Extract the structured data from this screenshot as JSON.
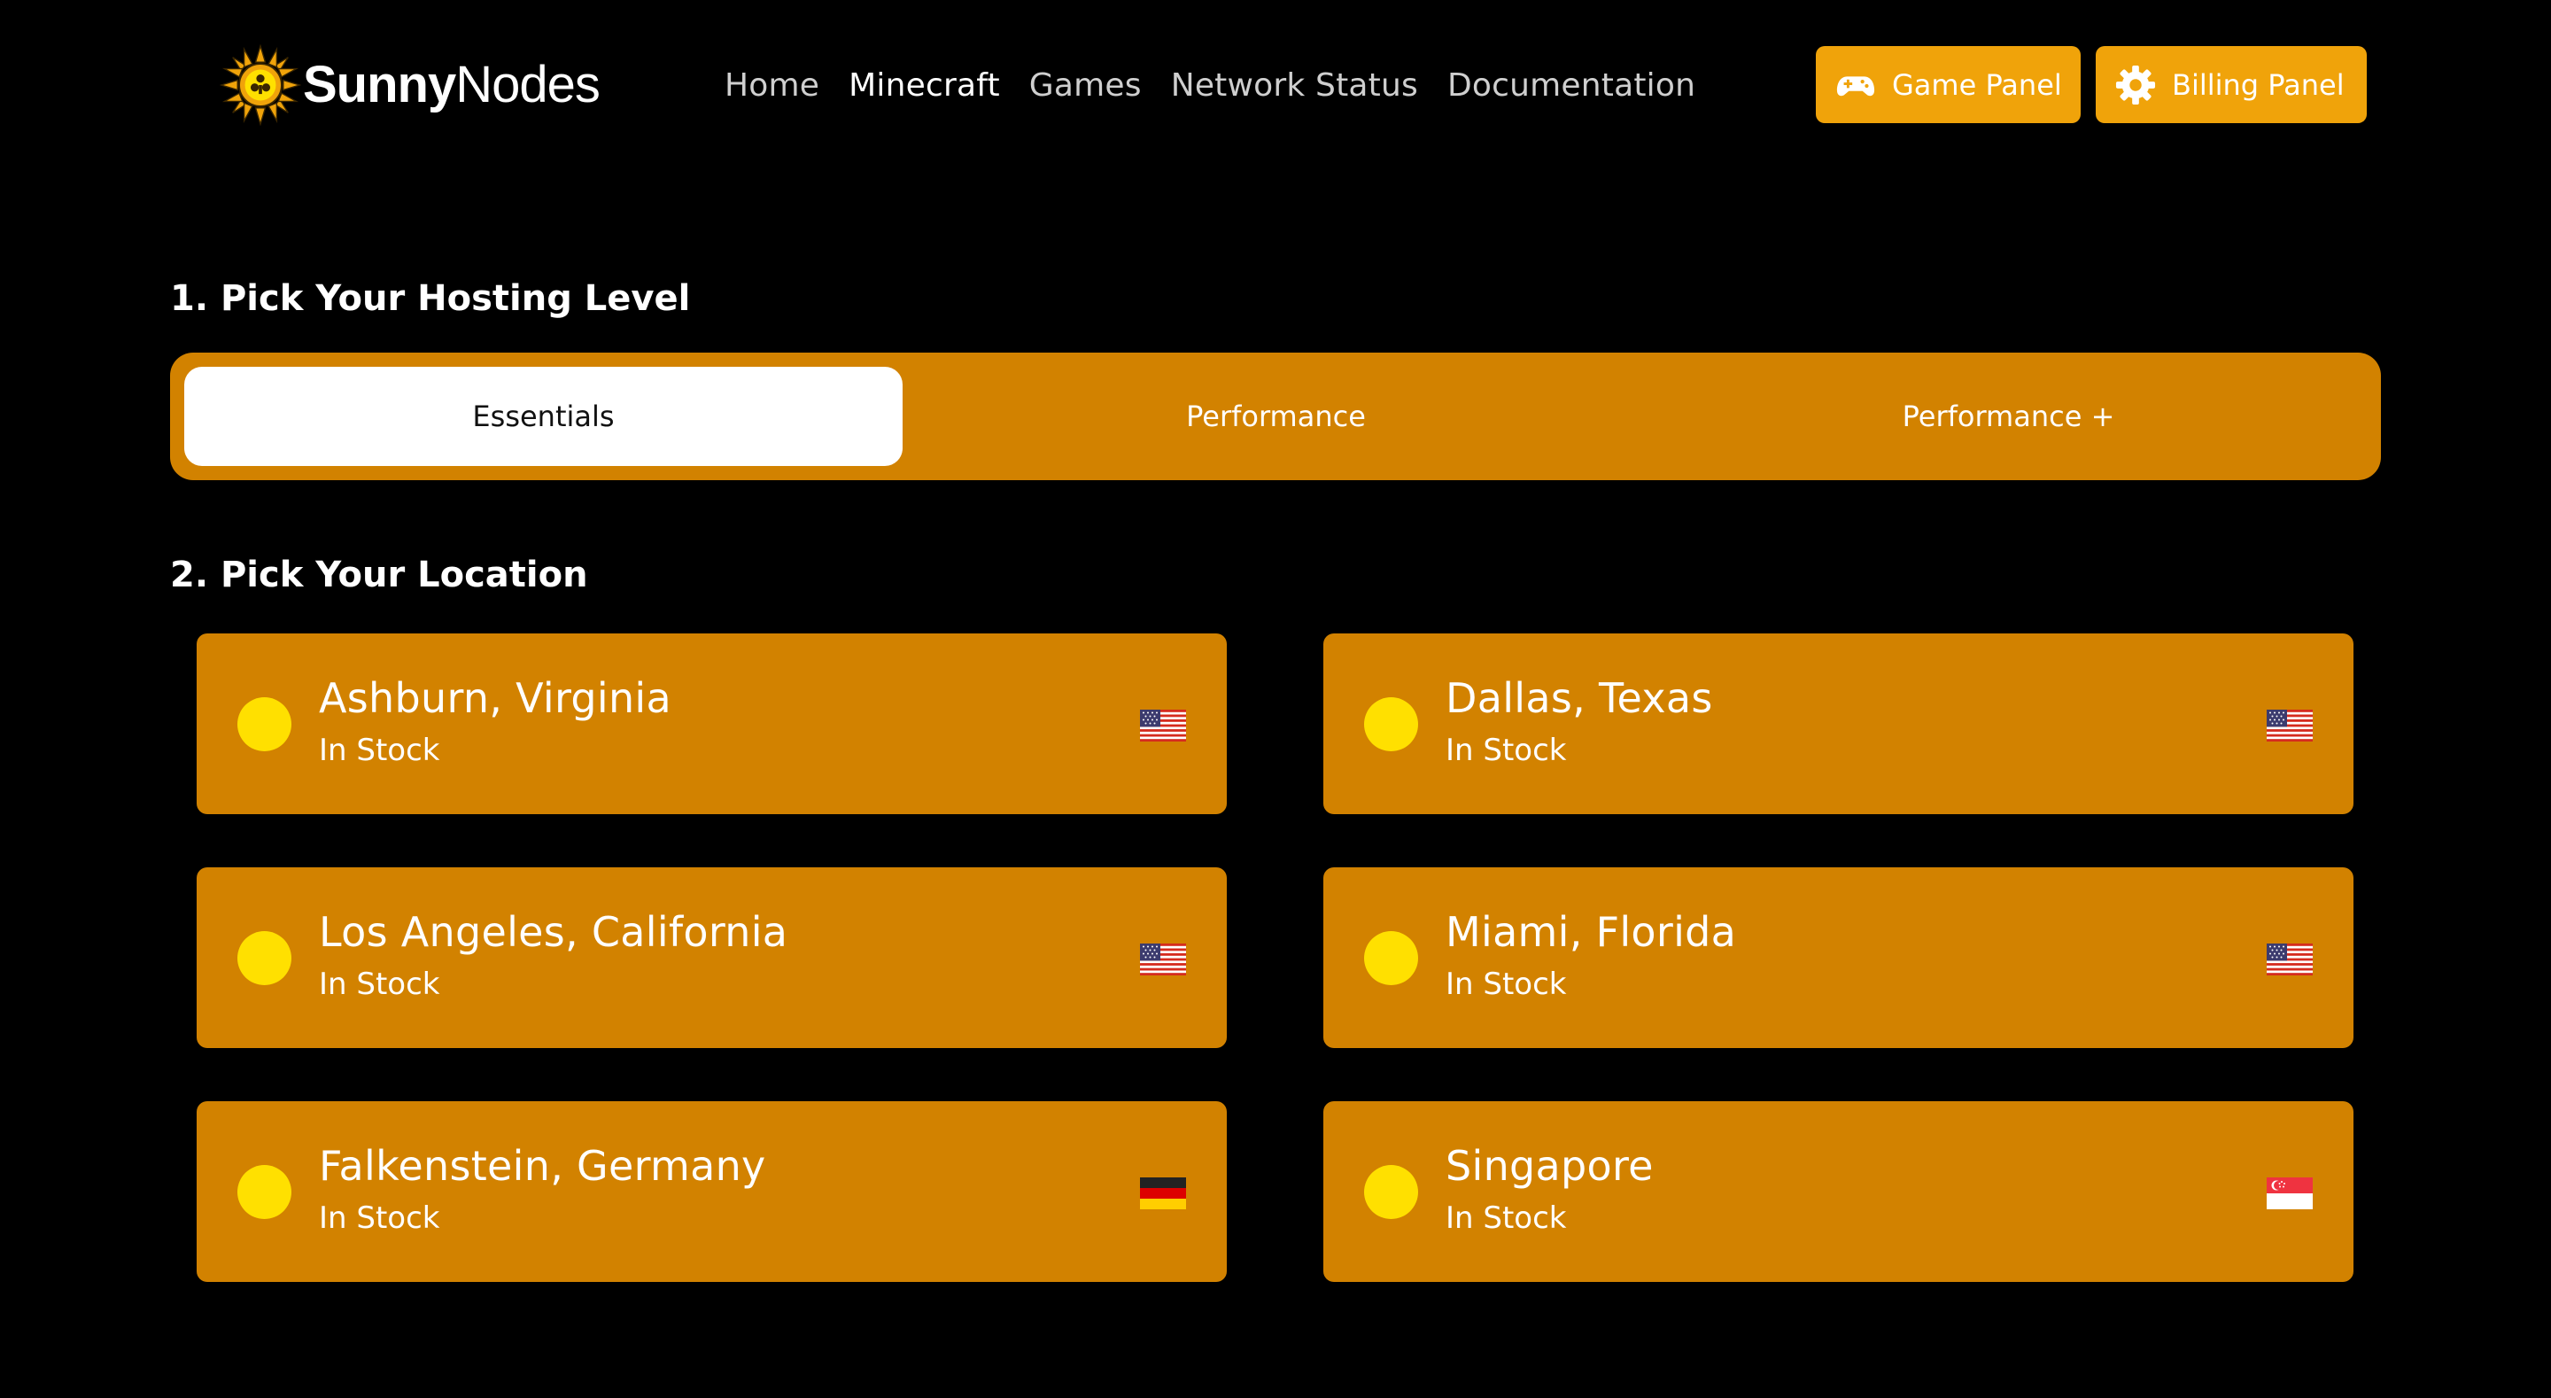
{
  "brand": {
    "name_bold": "Sunny",
    "name_light": "Nodes",
    "icon": "sun-logo-icon",
    "accent_color": "#f0a30a"
  },
  "nav": {
    "items": [
      {
        "label": "Home",
        "active": false
      },
      {
        "label": "Minecraft",
        "active": true
      },
      {
        "label": "Games",
        "active": false
      },
      {
        "label": "Network Status",
        "active": false
      },
      {
        "label": "Documentation",
        "active": false
      }
    ]
  },
  "header_buttons": {
    "game_panel": {
      "label": "Game Panel",
      "icon": "gamepad-icon"
    },
    "billing_panel": {
      "label": "Billing Panel",
      "icon": "gear-icon"
    }
  },
  "hosting": {
    "title": "1. Pick Your Hosting Level",
    "tiers": [
      {
        "label": "Essentials",
        "selected": true
      },
      {
        "label": "Performance",
        "selected": false
      },
      {
        "label": "Performance +",
        "selected": false
      }
    ]
  },
  "location": {
    "title": "2. Pick Your Location",
    "items": [
      {
        "name": "Ashburn, Virginia",
        "status": "In Stock",
        "flag": "us-flag-icon"
      },
      {
        "name": "Dallas, Texas",
        "status": "In Stock",
        "flag": "us-flag-icon"
      },
      {
        "name": "Los Angeles, California",
        "status": "In Stock",
        "flag": "us-flag-icon"
      },
      {
        "name": "Miami, Florida",
        "status": "In Stock",
        "flag": "us-flag-icon"
      },
      {
        "name": "Falkenstein, Germany",
        "status": "In Stock",
        "flag": "germany-flag-icon"
      },
      {
        "name": "Singapore",
        "status": "In Stock",
        "flag": "singapore-flag-icon"
      }
    ]
  },
  "colors": {
    "background": "#000000",
    "card": "#d28200",
    "radio": "#ffe000",
    "selected_tier": "#ffffff"
  }
}
